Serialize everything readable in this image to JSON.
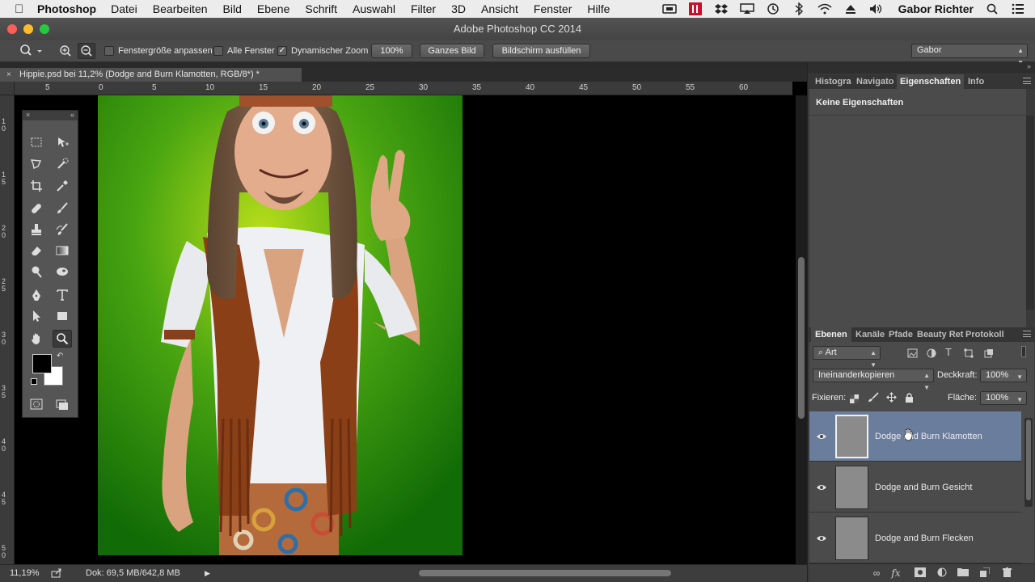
{
  "menubar": {
    "app": "Photoshop",
    "items": [
      "Datei",
      "Bearbeiten",
      "Bild",
      "Ebene",
      "Schrift",
      "Auswahl",
      "Filter",
      "3D",
      "Ansicht",
      "Fenster",
      "Hilfe"
    ],
    "user": "Gabor Richter"
  },
  "window": {
    "title": "Adobe Photoshop CC 2014"
  },
  "options": {
    "fit_window": "Fenstergröße anpassen",
    "all_windows": "Alle Fenster",
    "dynamic_zoom": "Dynamischer Zoom",
    "dynamic_zoom_checked": "✓",
    "zoom_100": "100%",
    "whole_image": "Ganzes Bild",
    "fill_screen": "Bildschirm ausfüllen",
    "workspace": "Gabor"
  },
  "document": {
    "tab_title": "Hippie.psd bei 11,2% (Dodge and Burn Klamotten, RGB/8*) *",
    "close": "×"
  },
  "rulers": {
    "top": [
      "5",
      "0",
      "5",
      "10",
      "15",
      "20",
      "25",
      "30",
      "35",
      "40",
      "45",
      "50",
      "55",
      "60"
    ],
    "left": [
      "1\n0",
      "1\n5",
      "2\n0",
      "2\n5",
      "3\n0",
      "3\n5",
      "4\n0",
      "4\n5",
      "5\n0"
    ]
  },
  "status": {
    "zoom": "11,19%",
    "doc": "Dok: 69,5 MB/642,8 MB"
  },
  "properties_panel": {
    "tabs": [
      "Histogra",
      "Navigato",
      "Eigenschaften",
      "Info"
    ],
    "active_tab": "Eigenschaften",
    "message": "Keine Eigenschaften"
  },
  "layers_panel": {
    "tabs": [
      "Ebenen",
      "Kanäle",
      "Pfade",
      "Beauty Ret",
      "Protokoll"
    ],
    "active_tab": "Ebenen",
    "filter_kind": "Art",
    "blend_mode": "Ineinanderkopieren",
    "opacity_label": "Deckkraft:",
    "opacity": "100%",
    "lock_label": "Fixieren:",
    "fill_label": "Fläche:",
    "fill": "100%",
    "layers": [
      {
        "name": "Dodge and Burn Klamotten",
        "selected": true
      },
      {
        "name": "Dodge and Burn Gesicht",
        "selected": false
      },
      {
        "name": "Dodge and Burn Flecken",
        "selected": false
      }
    ],
    "footer_fx": "fx"
  },
  "colors": {
    "accent_selection": "#6b7d9c",
    "canvas_green": "#3f9a12",
    "panel_bg": "#4b4b4b"
  }
}
